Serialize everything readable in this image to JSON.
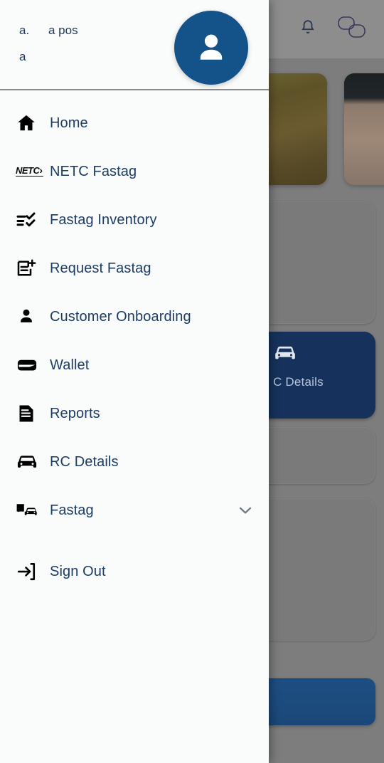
{
  "drawer": {
    "header": {
      "line1_part1": "a.",
      "line1_part2": "a pos",
      "line2": "a",
      "avatar_icon": "person-avatar-icon"
    },
    "menu_items": [
      {
        "label": "Home",
        "icon": "home-icon",
        "expandable": false
      },
      {
        "label": "NETC Fastag",
        "icon": "netc-logo-icon",
        "expandable": false
      },
      {
        "label": "Fastag Inventory",
        "icon": "checklist-icon",
        "expandable": false
      },
      {
        "label": "Request Fastag",
        "icon": "note-add-icon",
        "expandable": false
      },
      {
        "label": "Customer Onboarding",
        "icon": "person-icon",
        "expandable": false
      },
      {
        "label": "Wallet",
        "icon": "wallet-icon",
        "expandable": false
      },
      {
        "label": "Reports",
        "icon": "document-icon",
        "expandable": false
      },
      {
        "label": "RC Details",
        "icon": "car-icon",
        "expandable": false
      },
      {
        "label": "Fastag",
        "icon": "bus-car-icon",
        "expandable": true,
        "chevron_icon": "chevron-down-icon"
      },
      {
        "label": "Sign Out",
        "icon": "sign-out-icon",
        "expandable": false
      }
    ]
  },
  "background": {
    "appbar": {
      "notification_icon": "bell-icon",
      "chat_icon": "chat-bubbles-icon"
    },
    "rc_card": {
      "label": "C Details",
      "icon": "car-icon"
    }
  },
  "colors": {
    "drawer_bg": "#fafbfb",
    "menu_text": "#1d3c66",
    "avatar_bg": "#14538a",
    "rc_card_bg": "#16325c",
    "bottom_button": "#1d4e83",
    "scrim": "#7d7d7d"
  }
}
